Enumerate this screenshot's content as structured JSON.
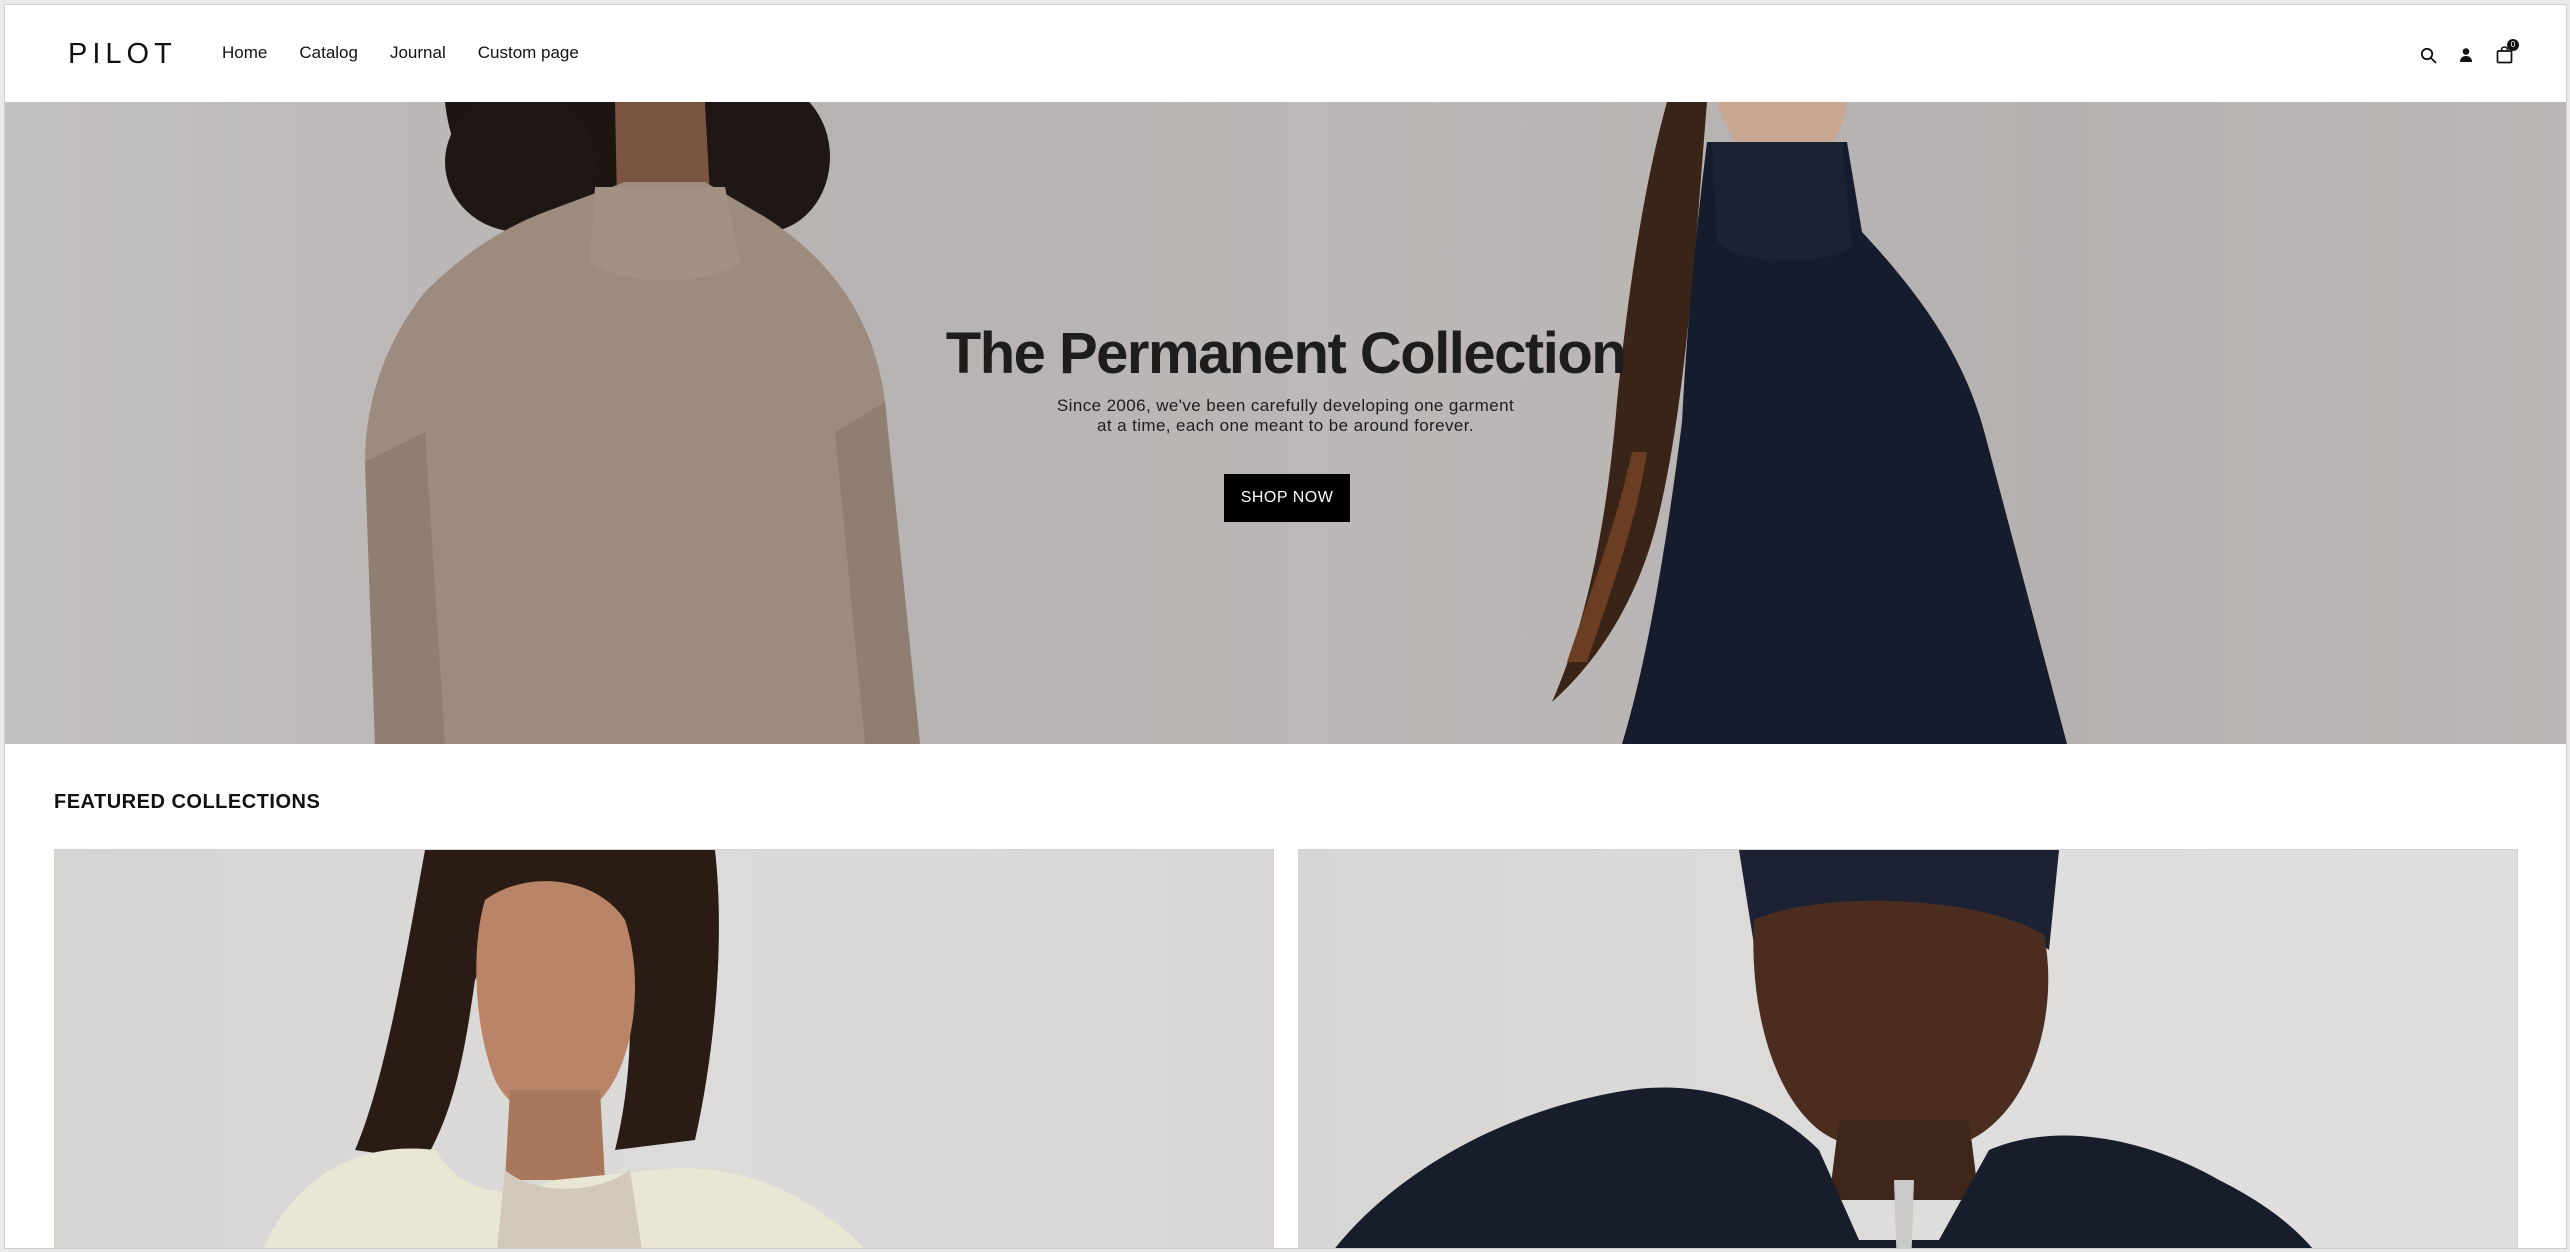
{
  "header": {
    "logo": "PILOT",
    "nav": [
      {
        "label": "Home"
      },
      {
        "label": "Catalog"
      },
      {
        "label": "Journal"
      },
      {
        "label": "Custom page"
      }
    ],
    "icons": [
      "search-icon",
      "account-icon",
      "cart-icon"
    ],
    "cart_count": "0"
  },
  "hero": {
    "title": "The Permanent Collection",
    "subtitle_line1": "Since 2006, we've been carefully developing one garment",
    "subtitle_line2": "at a time, each one meant to be around forever.",
    "cta_label": "SHOP NOW"
  },
  "featured": {
    "title": "FEATURED COLLECTIONS"
  },
  "colors": {
    "hero_bg": "#bdb9b9",
    "button_bg": "#000000",
    "text": "#1d1d1d"
  }
}
